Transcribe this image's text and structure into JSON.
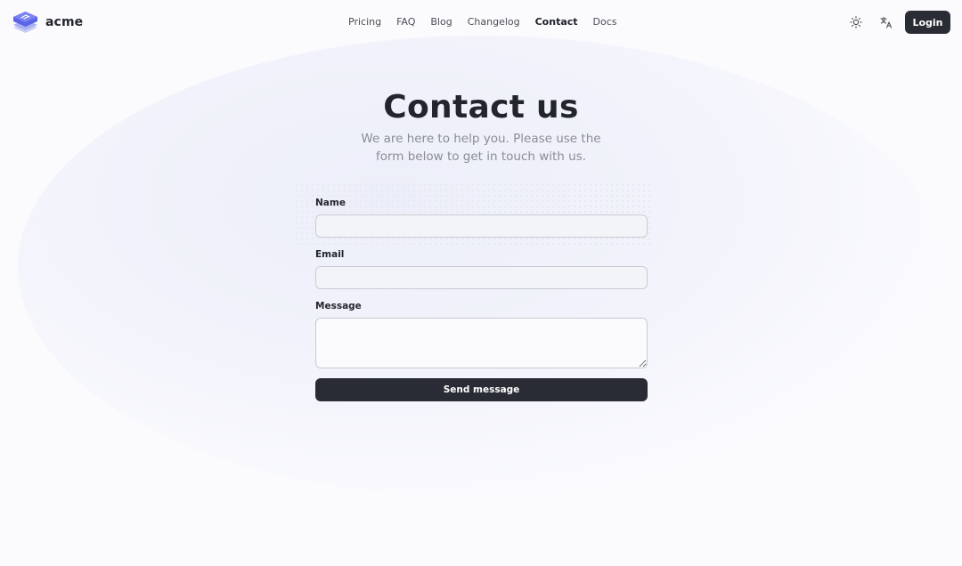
{
  "brand": {
    "name": "acme"
  },
  "nav": {
    "items": [
      {
        "label": "Pricing"
      },
      {
        "label": "FAQ"
      },
      {
        "label": "Blog"
      },
      {
        "label": "Changelog"
      },
      {
        "label": "Contact"
      },
      {
        "label": "Docs"
      }
    ],
    "active": "Contact"
  },
  "header": {
    "theme_icon": "sun-icon",
    "language_icon": "translate-icon",
    "login_label": "Login"
  },
  "hero": {
    "title": "Contact us",
    "subtitle": "We are here to help you. Please use the form below to get in touch with us."
  },
  "form": {
    "name_label": "Name",
    "name_value": "",
    "email_label": "Email",
    "email_value": "",
    "message_label": "Message",
    "message_value": "",
    "submit_label": "Send message"
  },
  "colors": {
    "brand_accent": "#5b63e6",
    "button_dark": "#2a2c35",
    "background": "#fbfbfe",
    "subtitle_text": "#8a8c96"
  }
}
